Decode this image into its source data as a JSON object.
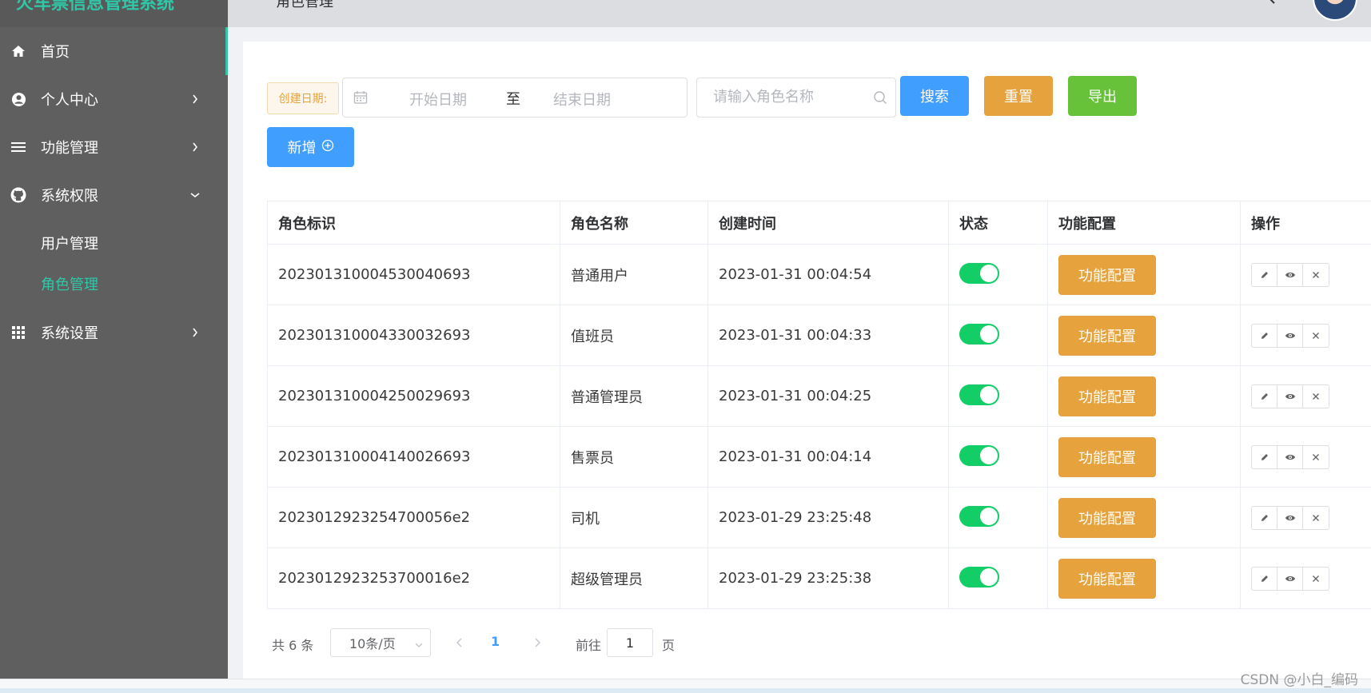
{
  "sidebar": {
    "brand": "火车票信息管理系统",
    "items": [
      {
        "label": "首页",
        "icon": "home-icon"
      },
      {
        "label": "个人中心",
        "icon": "user-circle-icon"
      },
      {
        "label": "功能管理",
        "icon": "bars-icon"
      },
      {
        "label": "系统权限",
        "icon": "github-icon"
      },
      {
        "label": "系统设置",
        "icon": "grid-icon"
      }
    ],
    "sub_items": [
      {
        "label": "用户管理"
      },
      {
        "label": "角色管理"
      }
    ],
    "active_color": "#2ec8a8"
  },
  "header": {
    "breadcrumb": "角色管理"
  },
  "filters": {
    "date_label": "创建日期:",
    "start_placeholder": "开始日期",
    "range_separator": "至",
    "end_placeholder": "结束日期",
    "name_placeholder": "请输入角色名称",
    "search_label": "搜索",
    "reset_label": "重置",
    "export_label": "导出",
    "add_label": "新增"
  },
  "table": {
    "columns": [
      "角色标识",
      "角色名称",
      "创建时间",
      "状态",
      "功能配置",
      "操作"
    ],
    "config_label": "功能配置",
    "rows": [
      {
        "id": "20230131000453004069​3",
        "name": "普通用户",
        "created": "2023-01-31 00:04:54",
        "enabled": true
      },
      {
        "id": "20230131000433003269​3",
        "name": "值班员",
        "created": "2023-01-31 00:04:33",
        "enabled": true
      },
      {
        "id": "20230131000425002969​3",
        "name": "普通管理员",
        "created": "2023-01-31 00:04:25",
        "enabled": true
      },
      {
        "id": "20230131000414002669​3",
        "name": "售票员",
        "created": "2023-01-31 00:04:14",
        "enabled": true
      },
      {
        "id": "2023012923254700056e2",
        "name": "司机",
        "created": "2023-01-29 23:25:48",
        "enabled": true
      },
      {
        "id": "2023012923253700016e2",
        "name": "超级管理员",
        "created": "2023-01-29 23:25:38",
        "enabled": true
      }
    ]
  },
  "pagination": {
    "total_text": "共 6 条",
    "page_size": "10条/页",
    "current_page": "1",
    "goto_prefix": "前往",
    "goto_value": "1",
    "goto_suffix": "页"
  },
  "watermark": "CSDN @小白_编码",
  "colors": {
    "primary": "#409eff",
    "warning": "#e6a23c",
    "success": "#67c23a",
    "switch_on": "#13ce66",
    "sidebar_bg": "#5f5f5f"
  }
}
